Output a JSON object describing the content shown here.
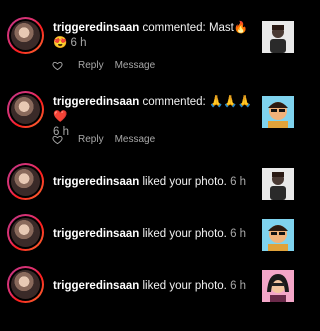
{
  "notifications": [
    {
      "user": "triggeredinsaan",
      "text": " commented: Mast🔥",
      "line2": "😍 ",
      "time": "6 h",
      "thumb": "man-bw-photo",
      "has_actions": true
    },
    {
      "user": "triggeredinsaan",
      "text": " commented: 🙏🙏🙏❤️",
      "line2": "",
      "time": "6 h",
      "thumb": "cartoon-man-sunglasses",
      "has_actions": true
    },
    {
      "user": "triggeredinsaan",
      "text": " liked your photo. ",
      "time": "6 h",
      "thumb": "man-bw-photo"
    },
    {
      "user": "triggeredinsaan",
      "text": " liked your photo. ",
      "time": "6 h",
      "thumb": "cartoon-man-sunglasses"
    },
    {
      "user": "triggeredinsaan",
      "text": " liked your photo. ",
      "time": "6 h",
      "thumb": "cartoon-woman-pink"
    }
  ],
  "actions": {
    "like_icon": "heart-outline-icon",
    "reply": "Reply",
    "message": "Message"
  },
  "colors": {
    "ring_start": "#c13584",
    "ring_end": "#f77737",
    "muted": "#a8a8a8",
    "bg": "#000000"
  }
}
